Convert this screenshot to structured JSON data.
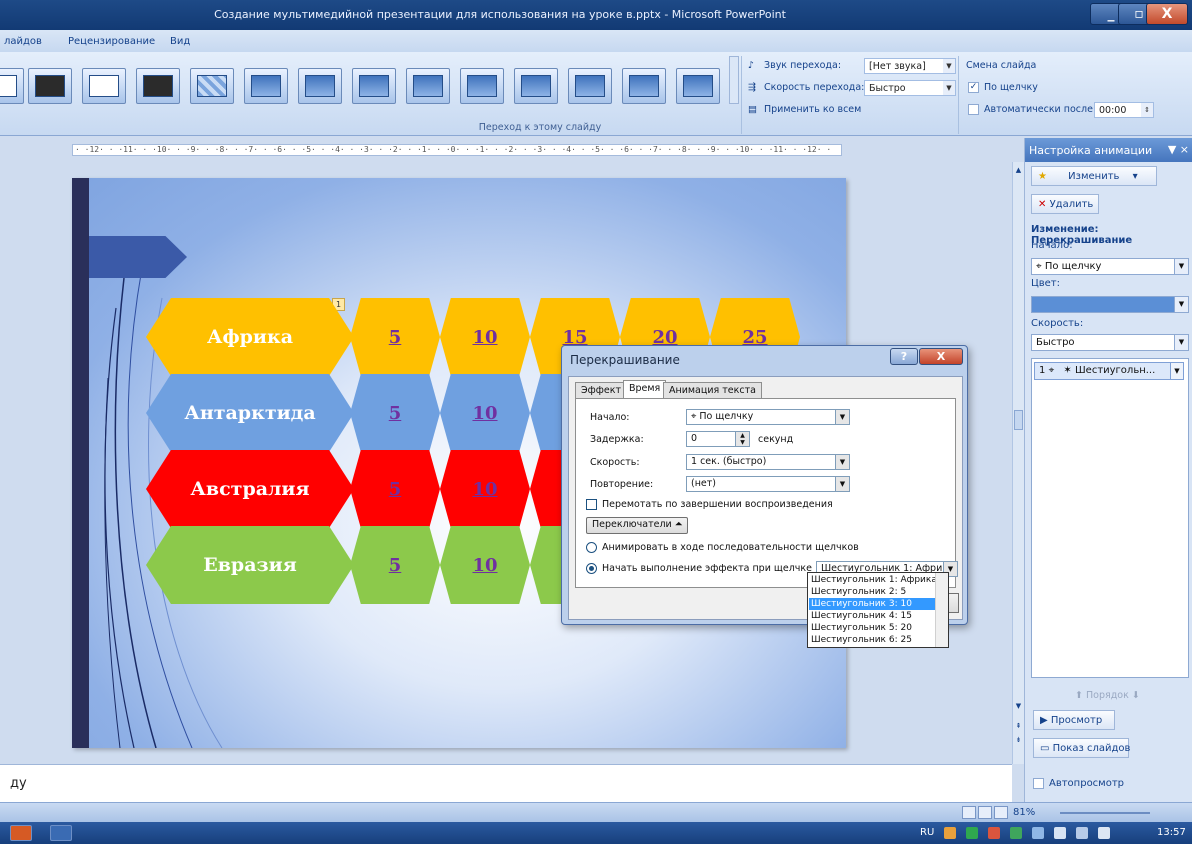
{
  "window": {
    "title": "Создание мультимедийной презентации для использования на уроке в.pptx - Microsoft PowerPoint",
    "min": "_",
    "max": "▫",
    "close": "X"
  },
  "menu": {
    "tab1": "лайдов",
    "tab2": "Рецензирование",
    "tab3": "Вид"
  },
  "ribbon": {
    "sound_label": "Звук перехода:",
    "sound_value": "[Нет звука]",
    "speed_label": "Скорость перехода:",
    "speed_value": "Быстро",
    "apply_all": "Применить ко всем",
    "advance_label": "Смена слайда",
    "on_click": "По щелчку",
    "auto_after": "Автоматически после:",
    "auto_time": "00:00",
    "group_caption": "Переход к этому слайду"
  },
  "ruler": {
    "text": "· ·12· · ·11· · ·10· · ·9· · ·8· · ·7· · ·6· · ·5· · ·4· · ·3· · ·2· · ·1· · ·0· · ·1· · ·2· · ·3· · ·4· · ·5· · ·6· · ·7· · ·8· · ·9· · ·10· · ·11· · ·12· ·"
  },
  "slide": {
    "marker": "1",
    "rows": [
      {
        "name": "Африка",
        "nums": [
          "5",
          "10",
          "15",
          "20",
          "25"
        ]
      },
      {
        "name": "Антарктида",
        "nums": [
          "5",
          "10"
        ]
      },
      {
        "name": "Австралия",
        "nums": [
          "5",
          "10"
        ]
      },
      {
        "name": "Евразия",
        "nums": [
          "5",
          "10"
        ]
      }
    ]
  },
  "notes": {
    "text": "ду"
  },
  "pane": {
    "title": "Настройка анимации",
    "change_btn": "Изменить",
    "delete_btn": "Удалить",
    "change_heading": "Изменение: Перекрашивание",
    "start_label": "Начало:",
    "start_value": "По щелчку",
    "color_label": "Цвет:",
    "speed_label": "Скорость:",
    "speed_value": "Быстро",
    "item_num": "1",
    "item_text": "Шестиугольн...",
    "order_label": "Порядок",
    "preview_btn": "Просмотр",
    "slideshow_btn": "Показ слайдов",
    "autopreview": "Автопросмотр"
  },
  "dialog": {
    "title": "Перекрашивание",
    "help": "?",
    "close": "X",
    "tabs": [
      "Эффект",
      "Время",
      "Анимация текста"
    ],
    "start_label": "Начало:",
    "start_value": "По щелчку",
    "delay_label": "Задержка:",
    "delay_value": "0",
    "delay_unit": "секунд",
    "speed_label": "Скорость:",
    "speed_value": "1 сек. (быстро)",
    "repeat_label": "Повторение:",
    "repeat_value": "(нет)",
    "rewind_label": "Перемотать по завершении воспроизведения",
    "triggers_btn": "Переключатели",
    "animate_seq": "Анимировать в ходе последовательности щелчков",
    "start_on_click": "Начать выполнение эффекта при щелчке",
    "trigger_value": "Шестиугольник 1: Африка"
  },
  "dropdown": {
    "options": [
      "Шестиугольник 1: Африка",
      "Шестиугольник 2: 5",
      "Шестиугольник 3: 10",
      "Шестиугольник 4: 15",
      "Шестиугольник 5: 20",
      "Шестиугольник 6: 25"
    ],
    "selected_index": 2
  },
  "status": {
    "zoom": "81%"
  },
  "taskbar": {
    "lang": "RU",
    "clock": "13:57"
  }
}
